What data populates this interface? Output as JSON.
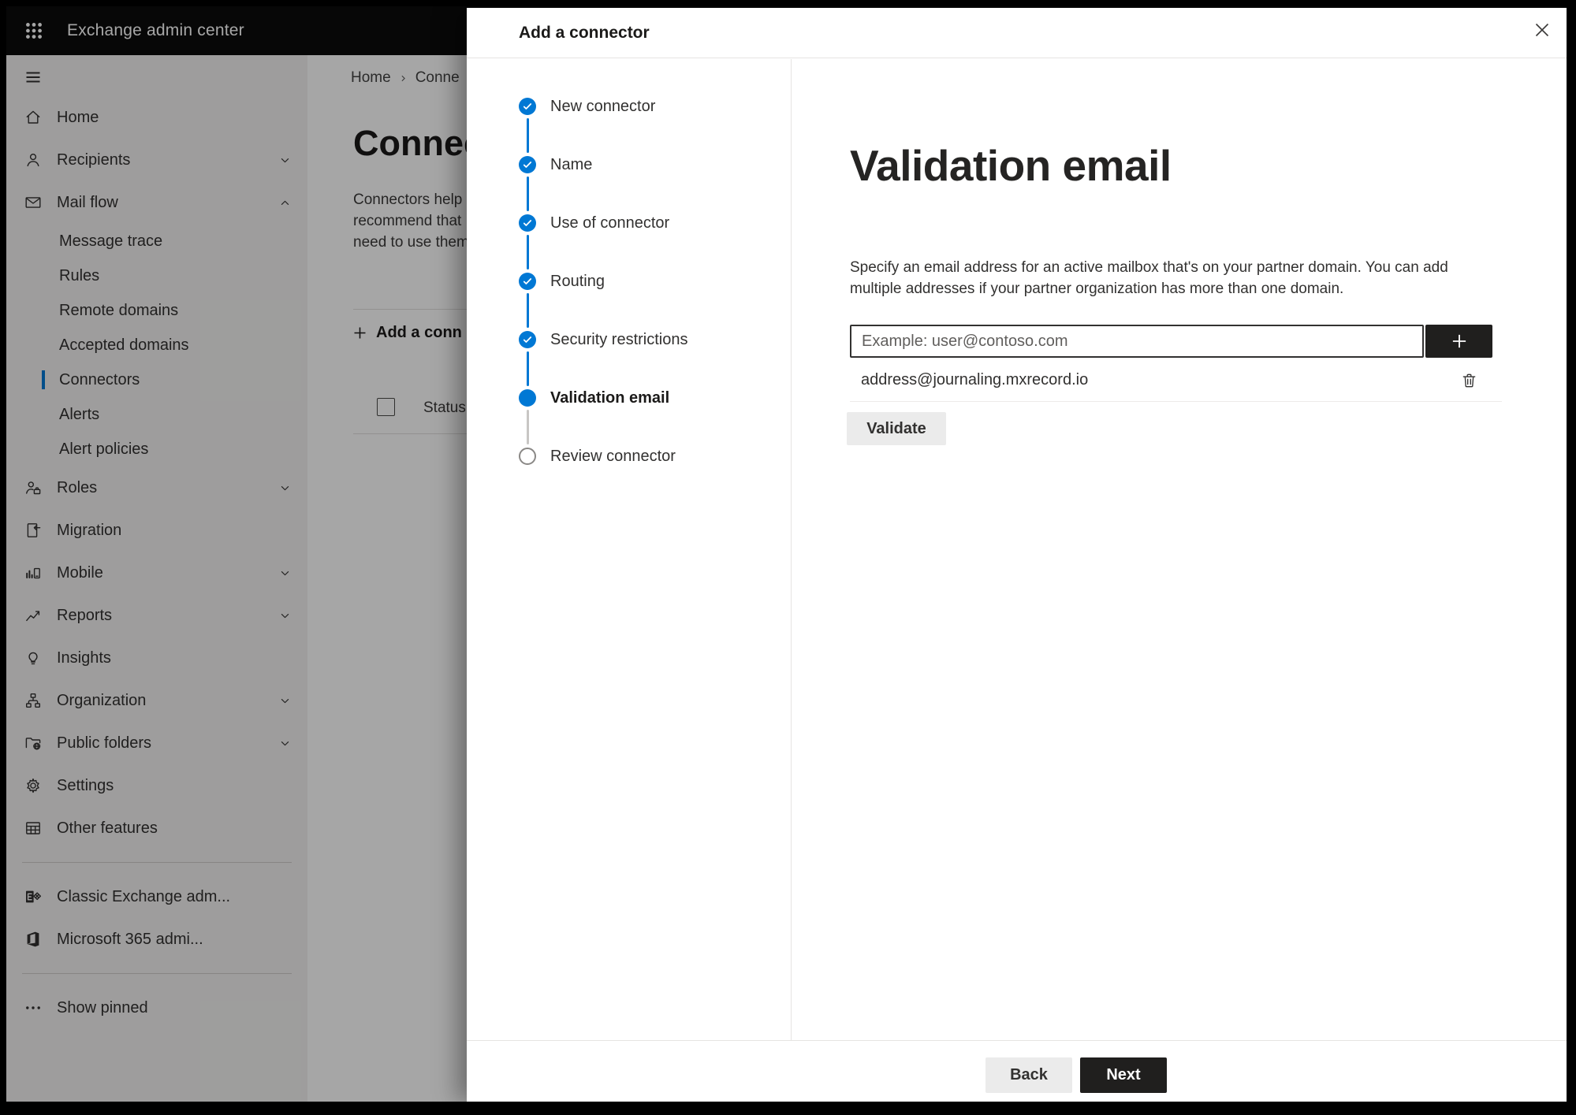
{
  "colors": {
    "accent": "#0078d4",
    "dark_button": "#201f1e",
    "topbar_bg": "#0c0c0c"
  },
  "topbar": {
    "title": "Exchange admin center"
  },
  "sidebar": {
    "items": [
      {
        "label": "Home",
        "icon": "home"
      },
      {
        "label": "Recipients",
        "icon": "person",
        "chevron": "down"
      },
      {
        "label": "Mail flow",
        "icon": "mail",
        "chevron": "up"
      },
      {
        "label": "Message trace",
        "sub": true
      },
      {
        "label": "Rules",
        "sub": true
      },
      {
        "label": "Remote domains",
        "sub": true
      },
      {
        "label": "Accepted domains",
        "sub": true
      },
      {
        "label": "Connectors",
        "sub": true,
        "selected": true
      },
      {
        "label": "Alerts",
        "sub": true
      },
      {
        "label": "Alert policies",
        "sub": true
      },
      {
        "label": "Roles",
        "icon": "roles",
        "chevron": "down"
      },
      {
        "label": "Migration",
        "icon": "migration"
      },
      {
        "label": "Mobile",
        "icon": "mobile",
        "chevron": "down"
      },
      {
        "label": "Reports",
        "icon": "reports",
        "chevron": "down"
      },
      {
        "label": "Insights",
        "icon": "insights"
      },
      {
        "label": "Organization",
        "icon": "organization",
        "chevron": "down"
      },
      {
        "label": "Public folders",
        "icon": "public-folders",
        "chevron": "down"
      },
      {
        "label": "Settings",
        "icon": "settings"
      },
      {
        "label": "Other features",
        "icon": "other-features"
      }
    ],
    "footer_items": [
      {
        "label": "Classic Exchange adm...",
        "icon": "exchange"
      },
      {
        "label": "Microsoft 365 admi...",
        "icon": "microsoft365"
      }
    ],
    "show_pinned": {
      "label": "Show pinned",
      "icon": "ellipsis"
    }
  },
  "page_background": {
    "breadcrumb": {
      "home": "Home",
      "current": "Conne"
    },
    "title": "Connect",
    "intro_lines": [
      "Connectors help",
      "recommend that",
      "need to use them"
    ],
    "add_connector_label": "Add a conn",
    "status_column": "Status"
  },
  "modal": {
    "title": "Add a connector",
    "steps": [
      {
        "label": "New connector",
        "state": "done"
      },
      {
        "label": "Name",
        "state": "done"
      },
      {
        "label": "Use of connector",
        "state": "done"
      },
      {
        "label": "Routing",
        "state": "done"
      },
      {
        "label": "Security restrictions",
        "state": "done"
      },
      {
        "label": "Validation email",
        "state": "current"
      },
      {
        "label": "Review connector",
        "state": "todo"
      }
    ],
    "content": {
      "heading": "Validation email",
      "description": "Specify an email address for an active mailbox that's on your partner domain. You can add multiple addresses if your partner organization has more than one domain.",
      "email_placeholder": "Example: user@contoso.com",
      "emails": [
        "address@journaling.mxrecord.io"
      ],
      "validate_label": "Validate"
    },
    "footer": {
      "back_label": "Back",
      "next_label": "Next"
    }
  }
}
